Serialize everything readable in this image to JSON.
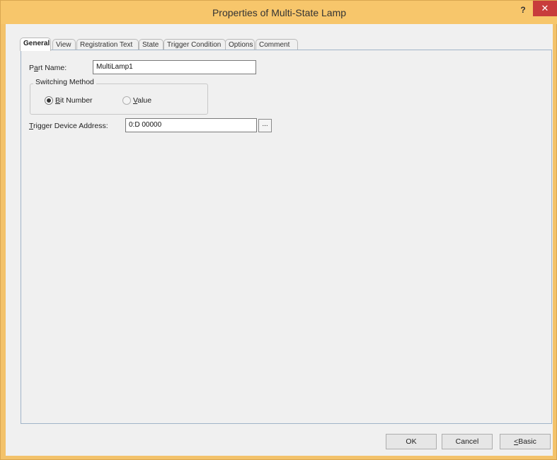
{
  "window": {
    "title": "Properties of Multi-State Lamp",
    "help_label": "?",
    "close_label": "✕"
  },
  "tabs": [
    {
      "label": "General",
      "active": true
    },
    {
      "label": "View"
    },
    {
      "label": "Registration Text"
    },
    {
      "label": "State"
    },
    {
      "label": "Trigger Condition"
    },
    {
      "label": "Options"
    },
    {
      "label": "Comment"
    }
  ],
  "general": {
    "part_name": {
      "label_pre": "P",
      "label_accel": "a",
      "label_post": "rt Name:",
      "value": "MultiLamp1"
    },
    "switching_method": {
      "title": "Switching Method",
      "options": [
        {
          "accel": "B",
          "rest": "it Number",
          "checked": true
        },
        {
          "accel": "V",
          "rest": "alue",
          "checked": false,
          "disabled": true
        }
      ]
    },
    "trigger_device": {
      "label_accel": "T",
      "label_rest": "rigger Device Address:",
      "value": "0:D 00000",
      "browse_label": "..."
    }
  },
  "buttons": {
    "ok": "OK",
    "cancel": "Cancel",
    "basic_accel": "<",
    "basic_rest": "Basic"
  }
}
